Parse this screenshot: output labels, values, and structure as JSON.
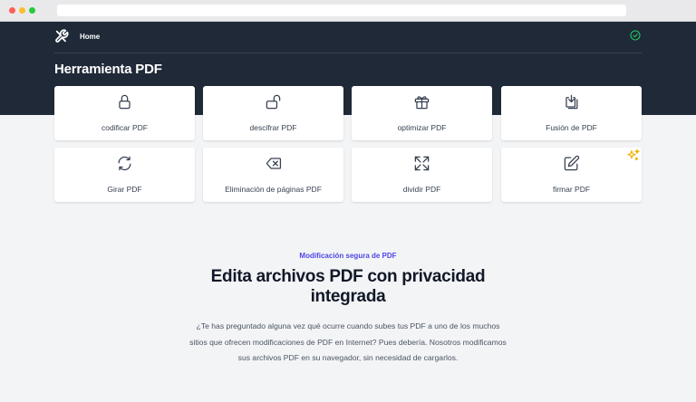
{
  "nav": {
    "home_label": "Home",
    "logo_icon": "tools-icon",
    "status_icon": "check-circle-icon"
  },
  "page": {
    "title": "Herramienta PDF"
  },
  "tools": [
    {
      "label": "codificar PDF",
      "icon": "lock-icon"
    },
    {
      "label": "descifrar PDF",
      "icon": "unlock-icon"
    },
    {
      "label": "optimizar PDF",
      "icon": "gift-icon"
    },
    {
      "label": "Fusión de PDF",
      "icon": "merge-download-icon"
    },
    {
      "label": "Girar PDF",
      "icon": "rotate-icon"
    },
    {
      "label": "Eliminación de páginas PDF",
      "icon": "backspace-delete-icon"
    },
    {
      "label": "dividir PDF",
      "icon": "expand-icon"
    },
    {
      "label": "firmar PDF",
      "icon": "pen-sign-icon"
    }
  ],
  "badge_icon": "sparkles-icon",
  "feature": {
    "eyebrow": "Modificación segura de PDF",
    "headline": "Edita archivos PDF con privacidad integrada",
    "body": "¿Te has preguntado alguna vez qué ocurre cuando subes tus PDF a uno de los muchos sitios que ofrecen modificaciones de PDF en Internet? Pues debería. Nosotros modificamos sus archivos PDF en su navegador, sin necesidad de cargarlos."
  },
  "colors": {
    "header_bg": "#1f2937",
    "accent": "#4f46e5",
    "status_green": "#22c55e",
    "sparkle_yellow": "#eab308"
  }
}
